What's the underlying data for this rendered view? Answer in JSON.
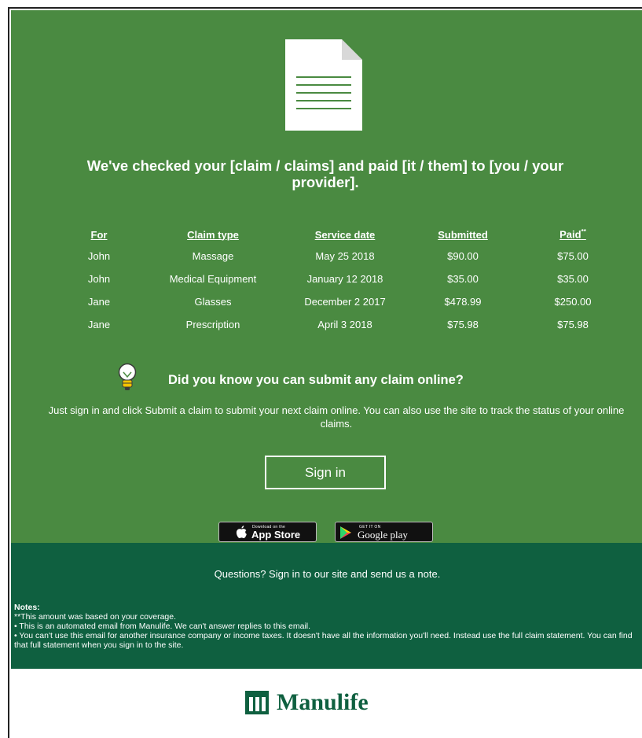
{
  "colors": {
    "primary_green": "#4a8a41",
    "dark_green": "#0f6040",
    "text_on_green": "#ffffff"
  },
  "hero": {
    "icon": "document-icon",
    "headline": "We've checked your [claim / claims] and paid [it / them] to [you / your provider]."
  },
  "claims_table": {
    "headers": {
      "for": "For",
      "claim_type": "Claim type",
      "service_date": "Service date",
      "submitted": "Submitted",
      "paid": "Paid",
      "paid_marker": "**"
    },
    "rows": [
      {
        "for": "John",
        "claim_type": "Massage",
        "service_date": "May 25 2018",
        "submitted": "$90.00",
        "paid": "$75.00"
      },
      {
        "for": "John",
        "claim_type": "Medical Equipment",
        "service_date": "January 12 2018",
        "submitted": "$35.00",
        "paid": "$35.00"
      },
      {
        "for": "Jane",
        "claim_type": "Glasses",
        "service_date": "December 2 2017",
        "submitted": "$478.99",
        "paid": "$250.00"
      },
      {
        "for": "Jane",
        "claim_type": "Prescription",
        "service_date": "April 3 2018",
        "submitted": "$75.98",
        "paid": "$75.98"
      }
    ]
  },
  "tip": {
    "icon": "lightbulb-icon",
    "heading": "Did you know you can submit any claim online?",
    "body": "Just sign in and click Submit a claim to submit your next claim online. You can also use the site to track the status of your online claims."
  },
  "signin_button": "Sign in",
  "app_badges": {
    "apple_small": "Download on the",
    "apple_big": "App Store",
    "google_small": "GET IT ON",
    "google_big": "Google play"
  },
  "footer": {
    "questions": "Questions? Sign in to our site and send us a note.",
    "notes_title": "Notes:",
    "notes": [
      "**This amount was based on your coverage.",
      "• This is an automated email from Manulife. We can't answer replies to this email.",
      "• You can't use this email for another insurance company or income taxes. It doesn't have all the information you'll need. Instead use the full claim statement. You can find that full statement when you sign in to the site."
    ]
  },
  "brand": {
    "logo_icon": "manulife-logo-icon",
    "name": "Manulife"
  }
}
